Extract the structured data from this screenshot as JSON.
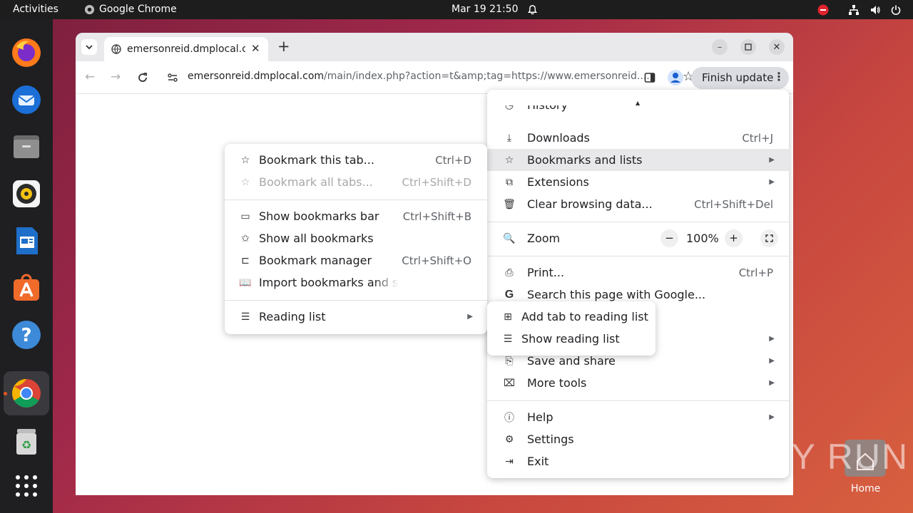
{
  "topbar": {
    "activities": "Activities",
    "app_name": "Google Chrome",
    "clock": "Mar 19  21:50"
  },
  "dock": {
    "items": [
      "firefox-icon",
      "thunderbird-icon",
      "files-icon",
      "rhythmbox-icon",
      "writer-icon",
      "software-icon",
      "help-icon",
      "chrome-icon",
      "trash-icon",
      "apps-grid-icon"
    ]
  },
  "browser": {
    "tab_title": "emersonreid.dmplocal.c",
    "url_host": "emersonreid.dmplocal.com",
    "url_path": "/main/index.php?action=t&amp;tag=https://www.emersonreid....",
    "update_button": "Finish update"
  },
  "main_menu": {
    "history": "History",
    "downloads": "Downloads",
    "downloads_sc": "Ctrl+J",
    "bookmarks": "Bookmarks and lists",
    "extensions": "Extensions",
    "clear": "Clear browsing data...",
    "clear_sc": "Ctrl+Shift+Del",
    "zoom": "Zoom",
    "zoom_minus": "−",
    "zoom_level": "100%",
    "zoom_plus": "+",
    "print": "Print...",
    "print_sc": "Ctrl+P",
    "search_page": "Search this page with Google...",
    "save_share": "Save and share",
    "more_tools": "More tools",
    "help": "Help",
    "settings": "Settings",
    "exit": "Exit"
  },
  "bookmarks_menu": {
    "bookmark_tab": "Bookmark this tab...",
    "bookmark_tab_sc": "Ctrl+D",
    "bookmark_all": "Bookmark all tabs...",
    "bookmark_all_sc": "Ctrl+Shift+D",
    "show_bar": "Show bookmarks bar",
    "show_bar_sc": "Ctrl+Shift+B",
    "show_all": "Show all bookmarks",
    "manager": "Bookmark manager",
    "manager_sc": "Ctrl+Shift+O",
    "import": "Import bookmarks and set",
    "reading_list": "Reading list"
  },
  "reading_menu": {
    "add": "Add tab to reading list",
    "show": "Show reading list"
  },
  "desktop": {
    "home_label": "Home",
    "watermark": "ANY RUN"
  },
  "colors": {
    "accent": "#e95420",
    "menu_highlight": "#e8e8ea",
    "update_bg": "#dcdde3"
  }
}
